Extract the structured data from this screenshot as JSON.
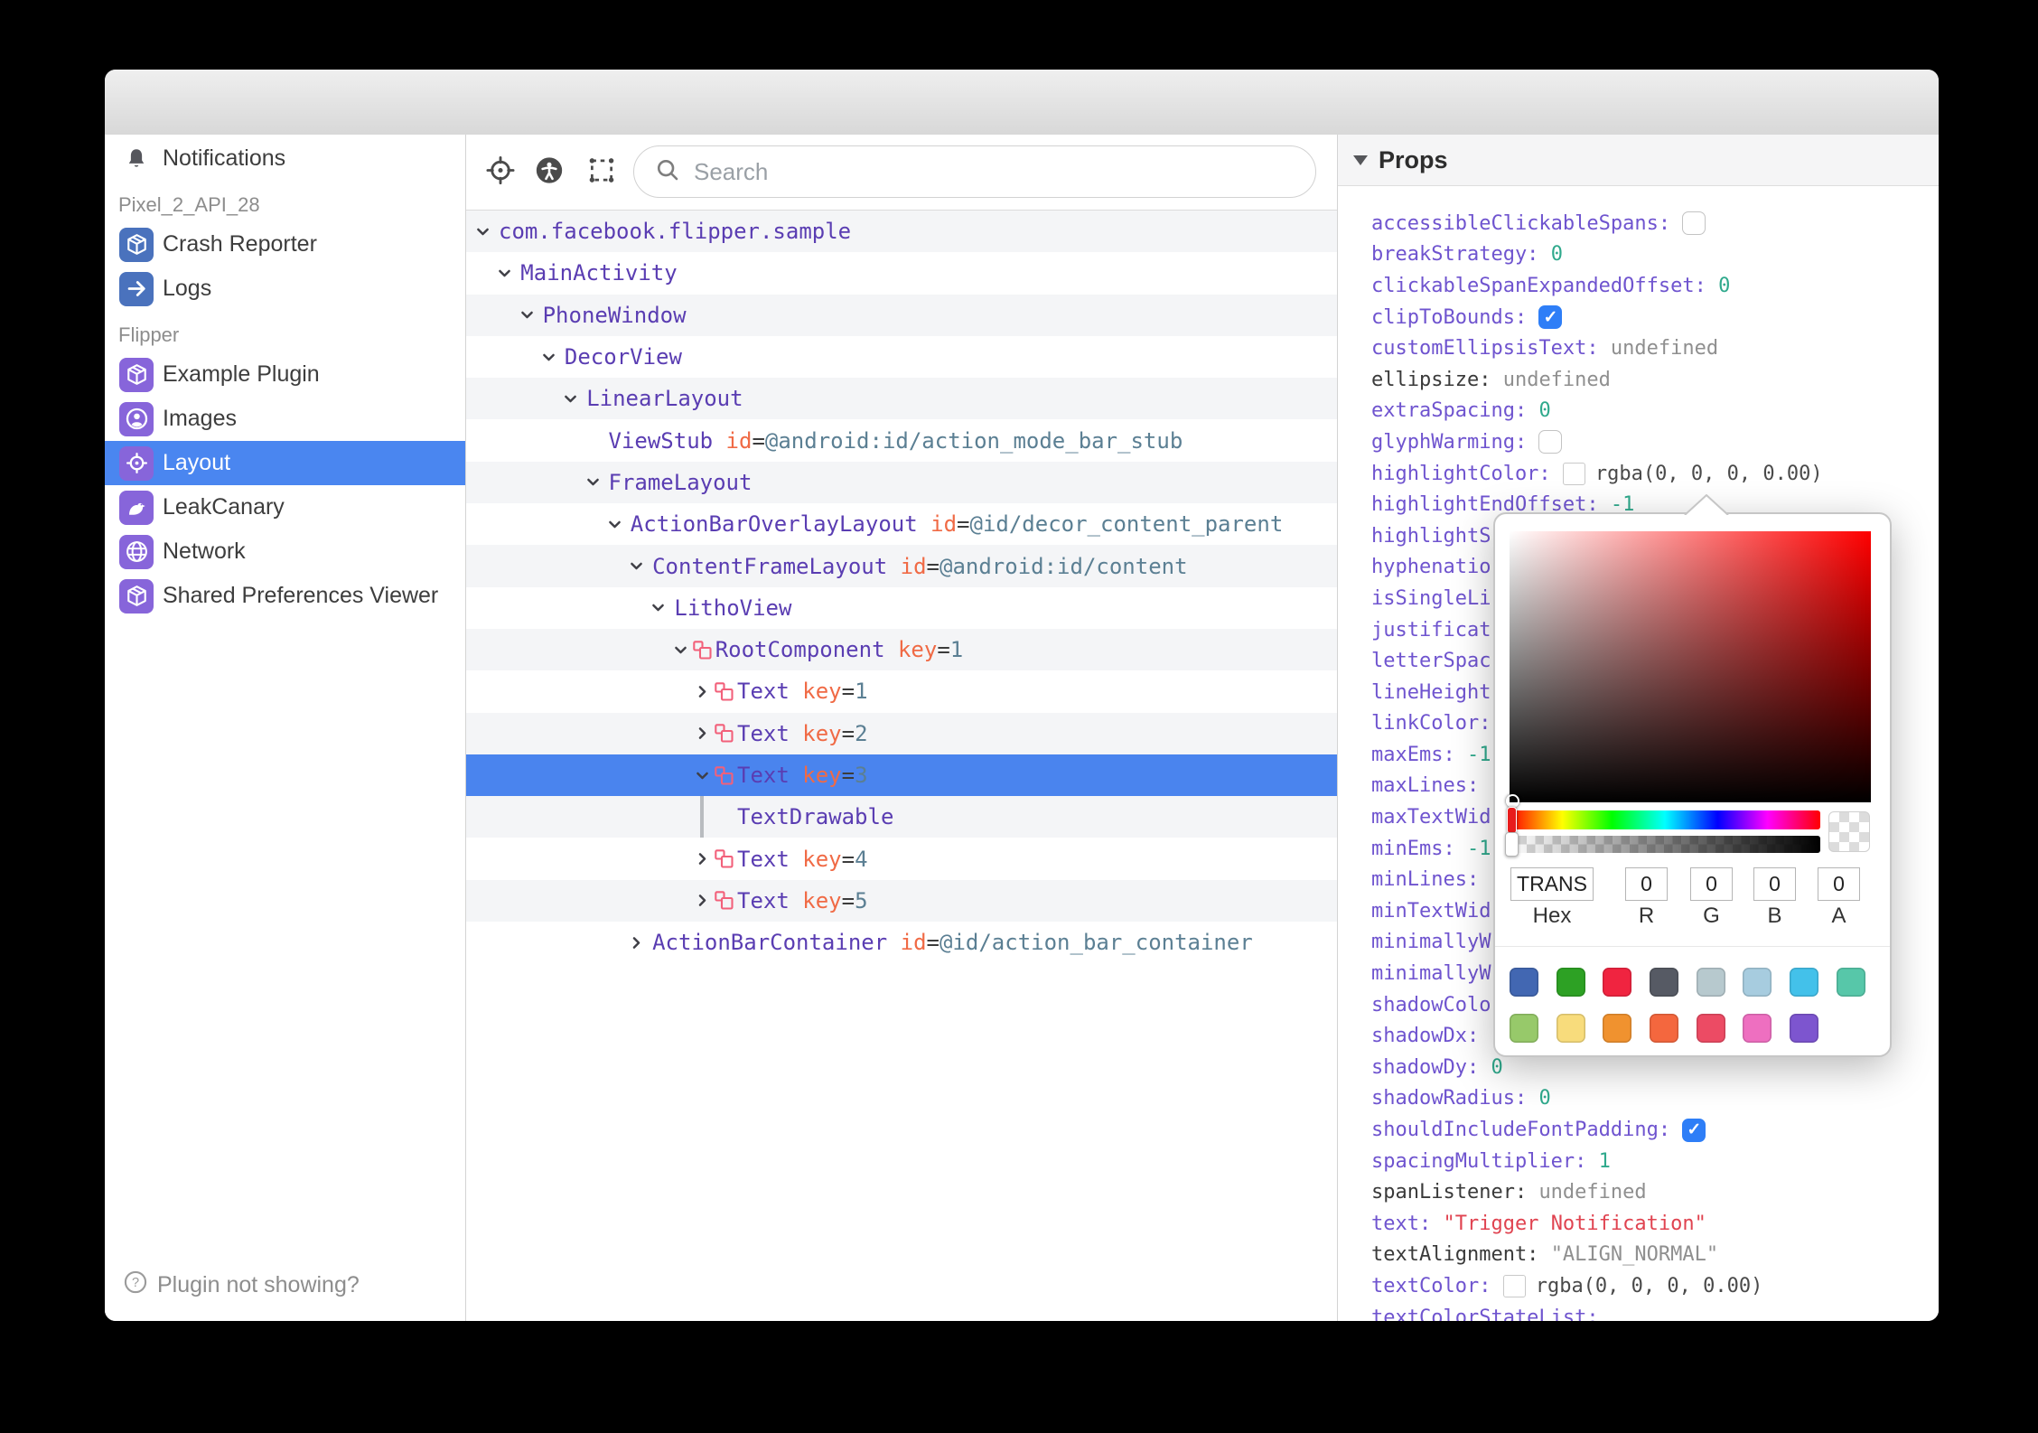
{
  "colors": {
    "selection_blue": "#4a84ee",
    "sidebar_selected_blue": "#4a86f0",
    "device_plugin_icon_bg": "#4a72bd",
    "flipper_plugin_icon_bg": "#8765da",
    "tree_name_purple": "#5a3db2",
    "tree_attr_orange": "#f06a45",
    "tree_value_teal": "#5b7f93",
    "prop_key_purple": "#6f54cf",
    "prop_value_green": "#2fa98c",
    "prop_string_red": "#e04350",
    "litho_icon_salmon": "#f2607a",
    "checkbox_blue": "#2e7ef7"
  },
  "titlebar": {
    "device_label": "Pixel_2_API_28"
  },
  "sidebar": {
    "entries": [
      {
        "type": "item",
        "icon": "bell-icon",
        "label": "Notifications",
        "iconbg": null
      },
      {
        "type": "section",
        "label": "Pixel_2_API_28"
      },
      {
        "type": "item",
        "icon": "cube-icon",
        "label": "Crash Reporter",
        "iconbg": "#4a72bd"
      },
      {
        "type": "item",
        "icon": "arrow-right-icon",
        "label": "Logs",
        "iconbg": "#4a72bd"
      },
      {
        "type": "section",
        "label": "Flipper"
      },
      {
        "type": "item",
        "icon": "cube-icon",
        "label": "Example Plugin",
        "iconbg": "#8765da"
      },
      {
        "type": "item",
        "icon": "contact-icon",
        "label": "Images",
        "iconbg": "#8765da"
      },
      {
        "type": "item",
        "icon": "target-icon",
        "label": "Layout",
        "iconbg": "#8765da",
        "selected": true
      },
      {
        "type": "item",
        "icon": "bird-icon",
        "label": "LeakCanary",
        "iconbg": "#8765da"
      },
      {
        "type": "item",
        "icon": "globe-icon",
        "label": "Network",
        "iconbg": "#8765da"
      },
      {
        "type": "item",
        "icon": "cube-icon",
        "label": "Shared Preferences Viewer",
        "iconbg": "#8765da"
      }
    ],
    "footer_label": "Plugin not showing?"
  },
  "toolbar": {
    "search_placeholder": "Search"
  },
  "tree": {
    "rows": [
      {
        "level": 0,
        "chev": "down",
        "name": "com.facebook.flipper.sample"
      },
      {
        "level": 1,
        "chev": "down",
        "name": "MainActivity"
      },
      {
        "level": 2,
        "chev": "down",
        "name": "PhoneWindow"
      },
      {
        "level": 3,
        "chev": "down",
        "name": "DecorView"
      },
      {
        "level": 4,
        "chev": "down",
        "name": "LinearLayout"
      },
      {
        "level": 5,
        "chev": null,
        "name": "ViewStub",
        "attr": {
          "k": "id",
          "v": "@android:id/action_mode_bar_stub"
        }
      },
      {
        "level": 5,
        "chev": "down",
        "name": "FrameLayout"
      },
      {
        "level": 6,
        "chev": "down",
        "name": "ActionBarOverlayLayout",
        "attr": {
          "k": "id",
          "v": "@id/decor_content_parent"
        }
      },
      {
        "level": 7,
        "chev": "down",
        "name": "ContentFrameLayout",
        "attr": {
          "k": "id",
          "v": "@android:id/content"
        }
      },
      {
        "level": 8,
        "chev": "down",
        "name": "LithoView"
      },
      {
        "level": 9,
        "chev": "down",
        "litho": true,
        "name": "RootComponent",
        "attr": {
          "k": "key",
          "v": "1"
        }
      },
      {
        "level": 10,
        "chev": "right",
        "litho": true,
        "name": "Text",
        "attr": {
          "k": "key",
          "v": "1"
        }
      },
      {
        "level": 10,
        "chev": "right",
        "litho": true,
        "name": "Text",
        "attr": {
          "k": "key",
          "v": "2"
        }
      },
      {
        "level": 10,
        "chev": "down",
        "litho": true,
        "name": "Text",
        "attr": {
          "k": "key",
          "v": "3"
        },
        "selected": true
      },
      {
        "level": 10,
        "bar": true,
        "name": "TextDrawable"
      },
      {
        "level": 10,
        "chev": "right",
        "litho": true,
        "name": "Text",
        "attr": {
          "k": "key",
          "v": "4"
        }
      },
      {
        "level": 10,
        "chev": "right",
        "litho": true,
        "name": "Text",
        "attr": {
          "k": "key",
          "v": "5"
        }
      },
      {
        "level": 7,
        "chev": "right",
        "name": "ActionBarContainer",
        "attr": {
          "k": "id",
          "v": "@id/action_bar_container"
        }
      }
    ]
  },
  "props": {
    "title": "Props",
    "rows": [
      {
        "key": "accessibleClickableSpans",
        "colon": true,
        "widget": "cb-off"
      },
      {
        "key": "breakStrategy",
        "colon": true,
        "value": "0",
        "vc": "num"
      },
      {
        "key": "clickableSpanExpandedOffset",
        "colon": true,
        "value": "0",
        "vc": "num"
      },
      {
        "key": "clipToBounds",
        "colon": true,
        "widget": "cb-on"
      },
      {
        "key": "customEllipsisText",
        "colon": true,
        "value": "undefined",
        "vc": "undef"
      },
      {
        "key": "ellipsize",
        "kc": "plain",
        "colon": true,
        "value": "undefined",
        "vc": "undef"
      },
      {
        "key": "extraSpacing",
        "colon": true,
        "value": "0",
        "vc": "num"
      },
      {
        "key": "glyphWarming",
        "colon": true,
        "widget": "cb-off"
      },
      {
        "key": "highlightColor",
        "colon": true,
        "widget": "colorbox",
        "value": "rgba(0, 0, 0, 0.00)",
        "vc": "plain"
      },
      {
        "key": "highlightEndOffset",
        "colon": true,
        "value": "-1",
        "vc": "num"
      },
      {
        "key": "highlightS"
      },
      {
        "key": "hyphenatio"
      },
      {
        "key": "isSingleLi"
      },
      {
        "key": "justificat"
      },
      {
        "key": "letterSpac"
      },
      {
        "key": "lineHeight"
      },
      {
        "key": "linkColor",
        "colon": true
      },
      {
        "key": "maxEms",
        "colon": true,
        "value": "-1",
        "vc": "num"
      },
      {
        "key": "maxLines",
        "colon": true
      },
      {
        "key": "maxTextWid"
      },
      {
        "key": "minEms",
        "colon": true,
        "value": "-1",
        "vc": "num"
      },
      {
        "key": "minLines",
        "colon": true
      },
      {
        "key": "minTextWid"
      },
      {
        "key": "minimallyW"
      },
      {
        "key": "minimallyW"
      },
      {
        "key": "shadowColo"
      },
      {
        "key": "shadowDx",
        "colon": true
      },
      {
        "key": "shadowDy",
        "colon": true,
        "value": "0",
        "vc": "num"
      },
      {
        "key": "shadowRadius",
        "colon": true,
        "value": "0",
        "vc": "num"
      },
      {
        "key": "shouldIncludeFontPadding",
        "colon": true,
        "widget": "cb-on"
      },
      {
        "key": "spacingMultiplier",
        "colon": true,
        "value": "1",
        "vc": "num"
      },
      {
        "key": "spanListener",
        "kc": "plain",
        "colon": true,
        "value": "undefined",
        "vc": "undef"
      },
      {
        "key": "text",
        "colon": true,
        "value": "\"Trigger Notification\"",
        "vc": "str"
      },
      {
        "key": "textAlignment",
        "kc": "plain",
        "colon": true,
        "value": "\"ALIGN_NORMAL\"",
        "vc": "undef"
      },
      {
        "key": "textColor",
        "colon": true,
        "widget": "colorbox",
        "value": "rgba(0, 0, 0, 0.00)",
        "vc": "plain"
      },
      {
        "key": "textColorStateList",
        "colon": true
      }
    ]
  },
  "color_picker": {
    "hex": "TRANS",
    "r": "0",
    "g": "0",
    "b": "0",
    "a": "0",
    "field_labels": [
      "Hex",
      "R",
      "G",
      "B",
      "A"
    ],
    "swatches": [
      [
        "#4267B2",
        "#2DA124",
        "#F02440",
        "#565A64",
        "#B7C9CE",
        "#A7CCDF",
        "#43C1EA",
        "#57C7A9"
      ],
      [
        "#97C96A",
        "#F8DC7C",
        "#F0922F",
        "#F4673E",
        "#EC4B64",
        "#EE6FC0",
        "#7D55CF"
      ]
    ]
  }
}
